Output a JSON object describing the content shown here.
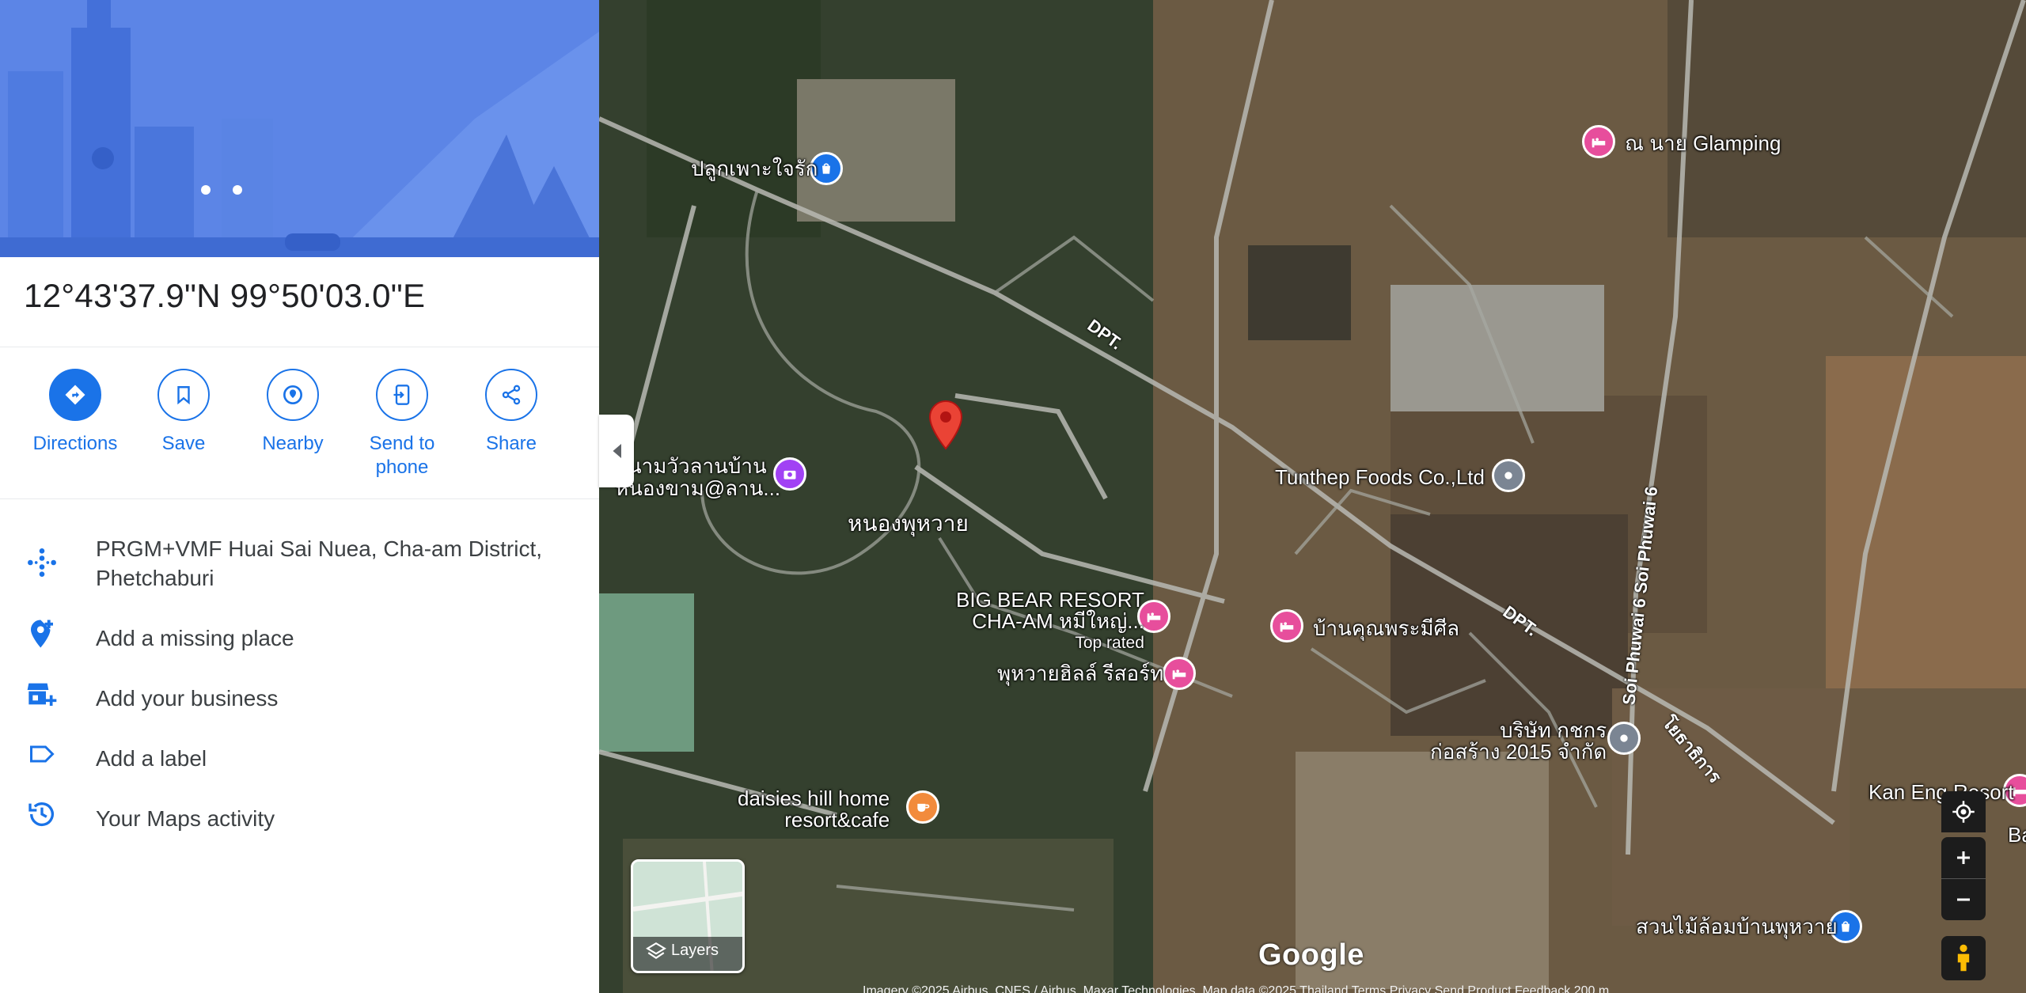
{
  "place": {
    "coordinates": "12°43'37.9\"N 99°50'03.0\"E"
  },
  "actions": [
    {
      "label": "Directions",
      "icon": "directions-icon"
    },
    {
      "label": "Save",
      "icon": "bookmark-icon"
    },
    {
      "label": "Nearby",
      "icon": "nearby-icon"
    },
    {
      "label": "Send to\nphone",
      "icon": "send-to-phone-icon"
    },
    {
      "label": "Share",
      "icon": "share-icon"
    }
  ],
  "details": {
    "plus_code": "PRGM+VMF Huai Sai Nuea, Cha-am District,\nPhetchaburi",
    "add_missing_place": "Add a missing place",
    "add_business": "Add your business",
    "add_label": "Add a label",
    "maps_activity": "Your Maps activity"
  },
  "map": {
    "labels": {
      "plukphao": "ปลูกเพาะใจรัก",
      "glamping": "ณ นาย Glamping",
      "sanam_line1": "สนามวัวลานบ้าน",
      "sanam_line2": "หนองขาม@ลาน...",
      "nongphu": "หนองพุหวาย",
      "tunthep": "Tunthep Foods Co.,Ltd",
      "bigbear_line1": "BIG BEAR RESORT",
      "bigbear_line2": "CHA-AM หมีใหญ่...",
      "bigbear_badge": "Top rated",
      "baankhun": "บ้านคุณพระมีศีล",
      "phuhuai": "พุหวายฮิลล์ รีสอร์ท",
      "company_line1": "บริษัท กชกร",
      "company_line2": "ก่อสร้าง 2015 จำกัด",
      "daisies_line1": "daisies hill home",
      "daisies_line2": "resort&cafe",
      "kaneng": "Kan Eng Resort",
      "banhuai": "Ban Hu Wai S",
      "suanmai": "สวนไม้ล้อมบ้านพุหวาย",
      "road_dpt1": "DPT.",
      "road_dpt2": "DPT.",
      "road_soi": "Soi Phuwai 6  Soi Phuwai 6",
      "road_thai": "โยธาธิการ"
    },
    "layers_label": "Layers",
    "logo": "Google",
    "attribution": "Imagery ©2025 Airbus, CNES / Airbus, Maxar Technologies, Map data ©2025    Thailand    Terms    Privacy    Send Product Feedback    200 m"
  },
  "colors": {
    "accent": "#1a73e8",
    "lodging_pin": "#e74e9c",
    "shopping_pin": "#1a73e8",
    "generic_pin": "#7b8593",
    "food_pin": "#f28b3c",
    "attraction_pin": "#a142f4",
    "selected_pin": "#ea4335"
  }
}
